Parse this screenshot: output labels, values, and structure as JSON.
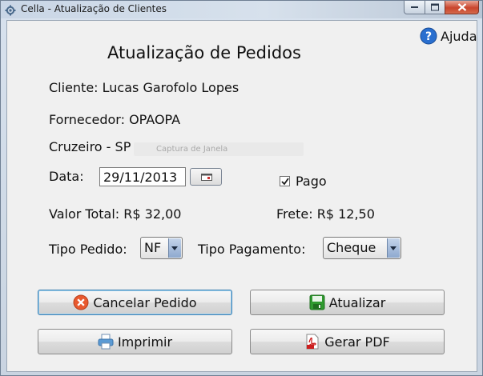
{
  "window": {
    "title": "Cella - Atualização de Clientes"
  },
  "help": {
    "label": "Ajuda"
  },
  "heading": "Atualização de Pedidos",
  "cliente": "Cliente: Lucas Garofolo Lopes",
  "fornecedor": "Fornecedor: OPAOPA",
  "local": "Cruzeiro - SP",
  "ghost_text": "Captura de Janela",
  "data": {
    "label": "Data:",
    "value": "29/11/2013"
  },
  "pago": {
    "label": "Pago",
    "checked": true
  },
  "valor_total": "Valor Total: R$ 32,00",
  "frete": "Frete: R$ 12,50",
  "tipo_pedido": {
    "label": "Tipo Pedido:",
    "value": "NF"
  },
  "tipo_pagamento": {
    "label": "Tipo Pagamento:",
    "value": "Cheque"
  },
  "buttons": {
    "cancelar": "Cancelar Pedido",
    "atualizar": "Atualizar",
    "imprimir": "Imprimir",
    "gerar_pdf": "Gerar PDF"
  },
  "icons": {
    "app": "gear-icon",
    "help": "help-icon",
    "calendar": "calendar-icon",
    "cancel": "cancel-icon",
    "save": "save-icon",
    "print": "printer-icon",
    "pdf": "pdf-icon"
  },
  "colors": {
    "help_blue": "#2a6fcf",
    "cancel_orange": "#e8592e",
    "save_green": "#2f9a2f",
    "pdf_red": "#cc1f1f"
  }
}
